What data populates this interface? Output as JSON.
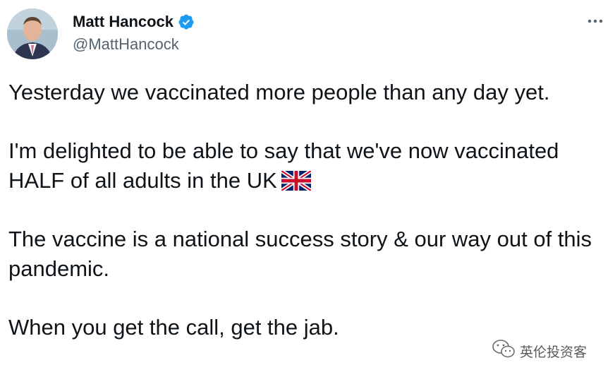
{
  "author": {
    "display_name": "Matt Hancock",
    "handle": "@MattHancock",
    "verified": true,
    "verified_color": "#1d9bf0"
  },
  "tweet": {
    "paragraphs": [
      "Yesterday we vaccinated more people than any day yet.",
      "I'm delighted to be able to say that we've now vaccinated HALF of all adults in the UK",
      "The vaccine is a national success story & our way out of this pandemic.",
      "When you get the call, get the jab."
    ],
    "inline_emoji": "uk-flag-icon"
  },
  "overlay": {
    "watermark_text": "英伦投资客",
    "watermark_icon": "wechat-icon"
  },
  "colors": {
    "text": "#0f1419",
    "secondary": "#536471",
    "verified": "#1d9bf0"
  }
}
